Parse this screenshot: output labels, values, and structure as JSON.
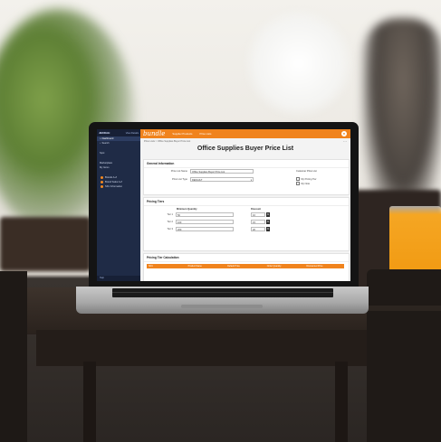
{
  "app": {
    "brand": "bundle",
    "top_menu": [
      "Supplier Products",
      "Price Lists"
    ],
    "breadcrumb": "Price Lists > Office Supplies Buyer Price List",
    "page_title": "Office Supplies Buyer Price List"
  },
  "sidebar": {
    "logo": "JEDDAH",
    "top_link": "View Details",
    "items": [
      "Dashboard",
      "Search",
      "Spot",
      "Marketplace",
      "My Items"
    ],
    "favorites": [
      "Brands A-Z",
      "Brand Sales A-Z",
      "SKU Information"
    ],
    "bottom": "Help"
  },
  "general_info": {
    "heading": "General Information",
    "price_list_name_label": "Price List Name",
    "price_list_name_value": "Office Supplies Buyer Price List",
    "price_list_type_label": "Price List Type",
    "price_list_type_value": "DEFAULT",
    "customer_label": "Customer Price List",
    "checkbox_1": "My Pricing Tier",
    "checkbox_2": "My Note"
  },
  "pricing_tiers": {
    "heading": "Pricing Tiers",
    "col_quantity": "Minimum Quantity",
    "col_discount": "Discount",
    "rows": [
      {
        "label": "Tier 1",
        "quantity": "50",
        "discount": "10"
      },
      {
        "label": "Tier 2",
        "quantity": "100",
        "discount": "15"
      },
      {
        "label": "Tier 3",
        "quantity": "200",
        "discount": "20"
      }
    ]
  },
  "calc": {
    "heading": "Pricing Tier Calculation",
    "columns": [
      "SKU",
      "Product Name",
      "Default Price",
      "Order Quantity",
      "Discounted Price"
    ]
  },
  "colors": {
    "accent": "#f0831d",
    "sidebar": "#1f2b46"
  }
}
